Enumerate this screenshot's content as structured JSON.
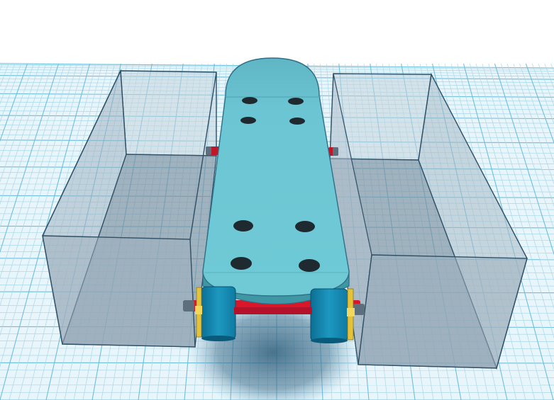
{
  "app": {
    "view": "3d-workplane"
  },
  "scene": {
    "workplane": {
      "grid_minor_color": "#a9d8ea",
      "grid_major_color": "#6ebfdc",
      "background_color": "#ffffff"
    },
    "objects": [
      {
        "name": "skateboard-deck",
        "color": "#6cc3d1",
        "holes": 8
      },
      {
        "name": "left-hole-box",
        "type": "transparent-hole",
        "color": "#8fa3b3"
      },
      {
        "name": "right-hole-box",
        "type": "transparent-hole",
        "color": "#8fa3b3"
      },
      {
        "name": "wheels",
        "color": "#1a90b6",
        "count": 2
      },
      {
        "name": "axle",
        "color": "#d8172b"
      },
      {
        "name": "axle-caps",
        "color": "#e4c33b"
      }
    ]
  }
}
